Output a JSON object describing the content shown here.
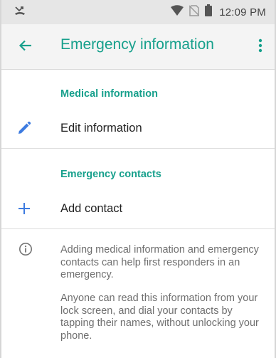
{
  "status_bar": {
    "time": "12:09 PM",
    "icons": [
      "missed-call-icon",
      "wifi-icon",
      "no-sim-icon",
      "battery-icon"
    ]
  },
  "app_bar": {
    "title": "Emergency information",
    "back_icon": "arrow-back-icon",
    "menu_icon": "more-vert-icon"
  },
  "sections": {
    "medical": {
      "header": "Medical information",
      "item_label": "Edit information",
      "item_icon": "pencil-icon"
    },
    "contacts": {
      "header": "Emergency contacts",
      "item_label": "Add contact",
      "item_icon": "plus-icon"
    }
  },
  "info": {
    "icon": "info-icon",
    "paragraph_1": "Adding medical information and emergency contacts can help first responders in an emergency.",
    "paragraph_2": "Anyone can read this information from your lock screen, and dial your contacts by tapping their names, without unlocking your phone."
  },
  "colors": {
    "accent": "#17a08c",
    "icon_blue": "#3d7be0",
    "app_bar_bg": "#f4f4f4",
    "status_bar_bg": "#e6e6e6"
  }
}
